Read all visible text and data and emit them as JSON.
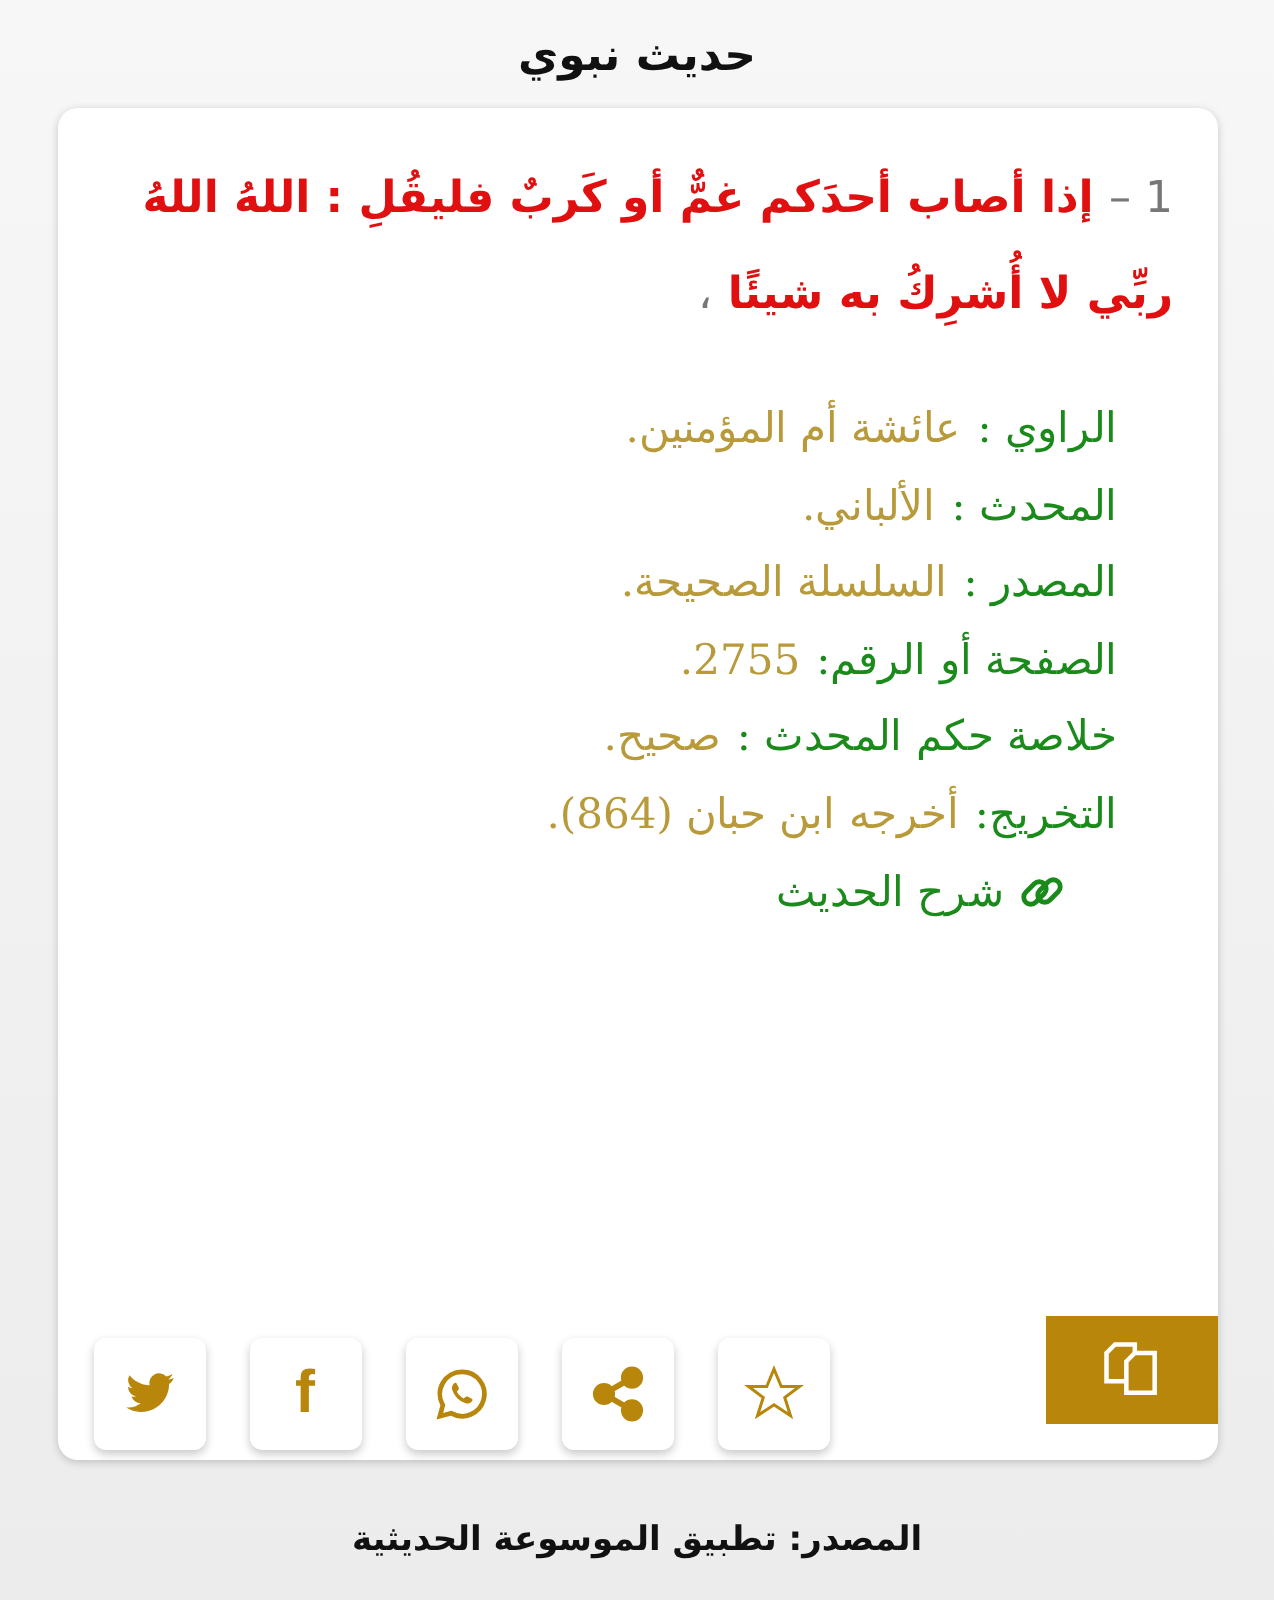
{
  "header": {
    "title": "حديث نبوي"
  },
  "hadith": {
    "number": "1 –",
    "text": "إذا أصاب أحدَكم غمٌّ أو كَربٌ فليقُلِ : اللهُ اللهُ ربِّي لا أُشرِكُ به شيئًا",
    "end_mark": "،"
  },
  "details": [
    {
      "label": "الراوي :",
      "value": "عائشة أم المؤمنين."
    },
    {
      "label": "المحدث :",
      "value": "الألباني."
    },
    {
      "label": "المصدر :",
      "value": "السلسلة الصحيحة."
    },
    {
      "label": "الصفحة أو الرقم:",
      "value": "2755."
    },
    {
      "label": "خلاصة حكم المحدث :",
      "value": "صحيح."
    },
    {
      "label": "التخريج:",
      "value": "أخرجه ابن حبان (864)."
    }
  ],
  "explanation_link": "شرح الحديث",
  "actions": [
    {
      "kind": "bird"
    },
    {
      "kind": "letter",
      "text": "f"
    },
    {
      "kind": "phone"
    },
    {
      "kind": "share"
    },
    {
      "kind": "star"
    }
  ],
  "footer": "المصدر: تطبيق الموسوعة الحديثية"
}
